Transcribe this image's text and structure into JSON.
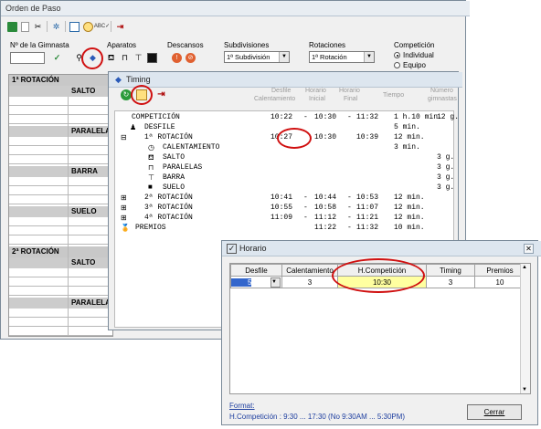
{
  "orden": {
    "title": "Orden de Paso",
    "num_gimnasta_label": "Nº de la Gimnasta",
    "aparatos_label": "Aparatos",
    "descansos_label": "Descansos",
    "subdivisiones_label": "Subdivisiones",
    "subdivision_value": "1ª Subdivisión",
    "rotaciones_label": "Rotaciones",
    "rotacion_value": "1ª Rotación",
    "competicion_label": "Competición",
    "opt_individual": "Individual",
    "opt_equipo": "Equipo",
    "rot1_header": "1ª ROTACIÓN",
    "rot2_header": "2ª ROTACIÓN",
    "salto": "SALTO",
    "paralelas": "PARALELA",
    "barra": "BARRA",
    "suelo": "SUELO"
  },
  "timing": {
    "title": "Timing",
    "headers": {
      "desfile_cal": [
        "Desfile",
        "Calentamiento"
      ],
      "horario_inicial": [
        "Horario",
        "Inicial"
      ],
      "horario_final": [
        "Horario",
        "Final"
      ],
      "tiempo": "Tiempo",
      "numero_gimnastas": [
        "Número",
        "gimnastas"
      ]
    },
    "rows": [
      {
        "name": "COMPETICIÓN",
        "c1": "10:22",
        "sep1": "-",
        "c2": "10:30",
        "sep2": "-",
        "c3": "11:32",
        "time": "1 h.10 min.",
        "g": "12 g."
      },
      {
        "name": "DESFILE",
        "c1": "",
        "sep1": "",
        "c2": "",
        "sep2": "",
        "c3": "",
        "time": "5 min.",
        "g": ""
      },
      {
        "name": "1ª ROTACIÓN",
        "c1": "10:27",
        "sep1": "",
        "c2": "10:30",
        "sep2": "",
        "c3": "10:39",
        "time": "12 min.",
        "g": ""
      },
      {
        "name": "CALENTAMIENTO",
        "c1": "",
        "sep1": "",
        "c2": "",
        "sep2": "",
        "c3": "",
        "time": "3 min.",
        "g": ""
      },
      {
        "name": "SALTO",
        "c1": "",
        "sep1": "",
        "c2": "",
        "sep2": "",
        "c3": "",
        "time": "",
        "g": "3 g."
      },
      {
        "name": "PARALELAS",
        "c1": "",
        "sep1": "",
        "c2": "",
        "sep2": "",
        "c3": "",
        "time": "",
        "g": "3 g."
      },
      {
        "name": "BARRA",
        "c1": "",
        "sep1": "",
        "c2": "",
        "sep2": "",
        "c3": "",
        "time": "",
        "g": "3 g."
      },
      {
        "name": "SUELO",
        "c1": "",
        "sep1": "",
        "c2": "",
        "sep2": "",
        "c3": "",
        "time": "",
        "g": "3 g."
      },
      {
        "name": "2ª ROTACIÓN",
        "c1": "10:41",
        "sep1": "-",
        "c2": "10:44",
        "sep2": "-",
        "c3": "10:53",
        "time": "12 min.",
        "g": ""
      },
      {
        "name": "3ª ROTACIÓN",
        "c1": "10:55",
        "sep1": "-",
        "c2": "10:58",
        "sep2": "-",
        "c3": "11:07",
        "time": "12 min.",
        "g": ""
      },
      {
        "name": "4ª ROTACIÓN",
        "c1": "11:09",
        "sep1": "-",
        "c2": "11:12",
        "sep2": "-",
        "c3": "11:21",
        "time": "12 min.",
        "g": ""
      },
      {
        "name": "PREMIOS",
        "c1": "",
        "sep1": "",
        "c2": "11:22",
        "sep2": "-",
        "c3": "11:32",
        "time": "10 min.",
        "g": ""
      }
    ]
  },
  "horario": {
    "title": "Horario",
    "columns": [
      "Desfile",
      "Calentamiento",
      "H.Competición",
      "Timing",
      "Premios"
    ],
    "row": {
      "desfile": "5",
      "calentamiento": "3",
      "h_competicion": "10:30",
      "timing": "3",
      "premios": "10"
    },
    "format_label": "Format:",
    "format_text": "H.Competición : 9:30 ... 17:30  (No 9:30AM ... 5:30PM)",
    "cerrar": "Cerrar"
  },
  "colors": {
    "accent_red": "#d01010",
    "highlight_yellow": "#ffffa0",
    "header_grey": "#c8c8c8"
  }
}
